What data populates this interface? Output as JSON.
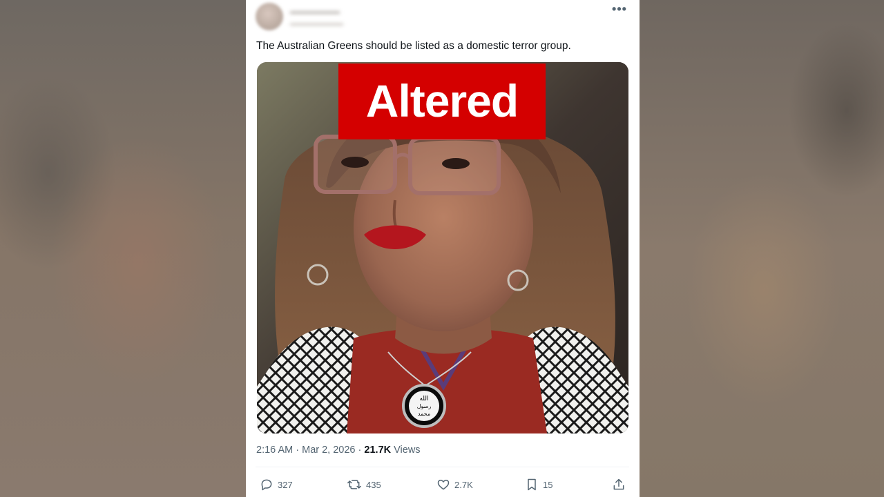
{
  "post": {
    "text": "The Australian Greens should be listed as a domestic terror group.",
    "time": "2:16 AM",
    "separator": "·",
    "date": "Mar 2, 2026",
    "views_count": "21.7K",
    "views_label": "Views",
    "more_glyph": "•••"
  },
  "overlay": {
    "label": "Altered",
    "color": "#d40000"
  },
  "pendant": {
    "line1": "الله",
    "line2": "رسول",
    "line3": "محمد"
  },
  "actions": {
    "replies": "327",
    "reposts": "435",
    "likes": "2.7K",
    "bookmarks": "15"
  },
  "icons": [
    "more-icon",
    "reply-icon",
    "repost-icon",
    "like-icon",
    "bookmark-icon",
    "share-icon"
  ]
}
